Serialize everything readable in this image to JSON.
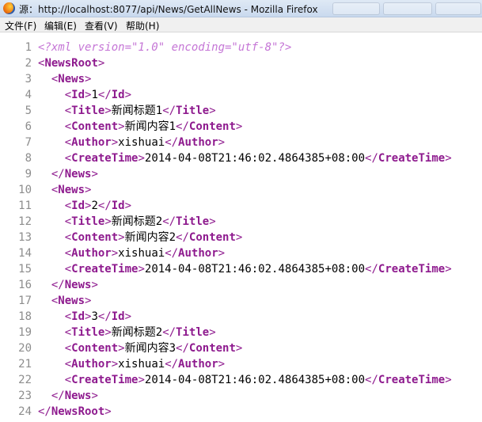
{
  "window": {
    "title": "源：http://localhost:8077/api/News/GetAllNews - Mozilla Firefox"
  },
  "menu": [
    "文件(F)",
    "编辑(E)",
    "查看(V)",
    "帮助(H)"
  ],
  "source": {
    "lines": [
      {
        "n": "1",
        "indent": 0,
        "kind": "pi",
        "text": "<?xml version=\"1.0\" encoding=\"utf-8\"?>"
      },
      {
        "n": "2",
        "indent": 0,
        "kind": "open",
        "tag": "NewsRoot"
      },
      {
        "n": "3",
        "indent": 1,
        "kind": "open",
        "tag": "News"
      },
      {
        "n": "4",
        "indent": 2,
        "kind": "elem",
        "tag": "Id",
        "value": "1"
      },
      {
        "n": "5",
        "indent": 2,
        "kind": "elem",
        "tag": "Title",
        "value": "新闻标题1"
      },
      {
        "n": "6",
        "indent": 2,
        "kind": "elem",
        "tag": "Content",
        "value": "新闻内容1"
      },
      {
        "n": "7",
        "indent": 2,
        "kind": "elem",
        "tag": "Author",
        "value": "xishuai"
      },
      {
        "n": "8",
        "indent": 2,
        "kind": "elem",
        "tag": "CreateTime",
        "value": "2014-04-08T21:46:02.4864385+08:00"
      },
      {
        "n": "9",
        "indent": 1,
        "kind": "close",
        "tag": "News"
      },
      {
        "n": "10",
        "indent": 1,
        "kind": "open",
        "tag": "News"
      },
      {
        "n": "11",
        "indent": 2,
        "kind": "elem",
        "tag": "Id",
        "value": "2"
      },
      {
        "n": "12",
        "indent": 2,
        "kind": "elem",
        "tag": "Title",
        "value": "新闻标题2"
      },
      {
        "n": "13",
        "indent": 2,
        "kind": "elem",
        "tag": "Content",
        "value": "新闻内容2"
      },
      {
        "n": "14",
        "indent": 2,
        "kind": "elem",
        "tag": "Author",
        "value": "xishuai"
      },
      {
        "n": "15",
        "indent": 2,
        "kind": "elem",
        "tag": "CreateTime",
        "value": "2014-04-08T21:46:02.4864385+08:00"
      },
      {
        "n": "16",
        "indent": 1,
        "kind": "close",
        "tag": "News"
      },
      {
        "n": "17",
        "indent": 1,
        "kind": "open",
        "tag": "News"
      },
      {
        "n": "18",
        "indent": 2,
        "kind": "elem",
        "tag": "Id",
        "value": "3"
      },
      {
        "n": "19",
        "indent": 2,
        "kind": "elem",
        "tag": "Title",
        "value": "新闻标题2"
      },
      {
        "n": "20",
        "indent": 2,
        "kind": "elem",
        "tag": "Content",
        "value": "新闻内容3"
      },
      {
        "n": "21",
        "indent": 2,
        "kind": "elem",
        "tag": "Author",
        "value": "xishuai"
      },
      {
        "n": "22",
        "indent": 2,
        "kind": "elem",
        "tag": "CreateTime",
        "value": "2014-04-08T21:46:02.4864385+08:00"
      },
      {
        "n": "23",
        "indent": 1,
        "kind": "close",
        "tag": "News"
      },
      {
        "n": "24",
        "indent": 0,
        "kind": "close",
        "tag": "NewsRoot"
      }
    ]
  },
  "colors": {
    "tag": "#8e1a8e",
    "processing_instruction": "#c576d6",
    "line_number": "#8d8d8d",
    "titlebar": "#d6e3f3",
    "menubar": "#f0f0f0"
  },
  "icons": {
    "app": "firefox-icon"
  }
}
